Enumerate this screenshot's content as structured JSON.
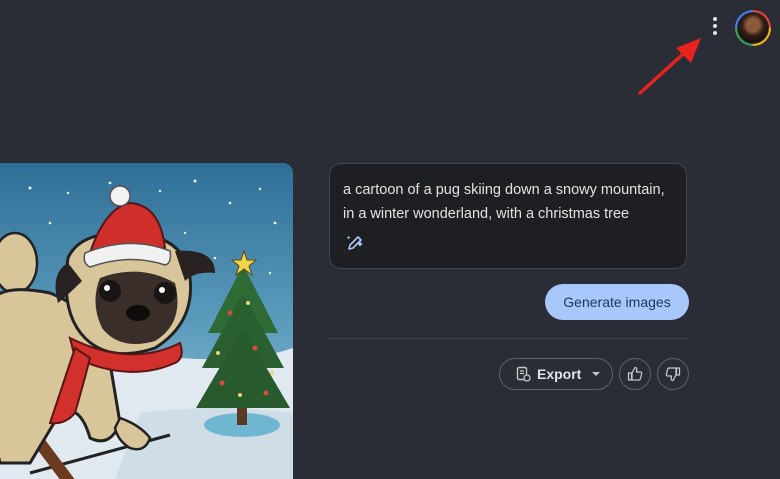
{
  "prompt": {
    "text": "a cartoon of a pug skiing down a snowy mountain, in a winter wonderland, with a christmas tree"
  },
  "actions": {
    "generate_label": "Generate images",
    "export_label": "Export"
  },
  "icons": {
    "more": "more-vert-icon",
    "avatar": "user-avatar",
    "edit": "edit-prompt-icon",
    "export": "export-doc-icon",
    "dropdown": "chevron-down-icon",
    "thumbs_up": "thumbs-up-icon",
    "thumbs_down": "thumbs-down-icon",
    "annotation": "red-arrow"
  },
  "colors": {
    "background": "#2a2c36",
    "card": "#1e1f22",
    "primary_button": "#a8c7fa",
    "annotation": "#e8231e"
  }
}
